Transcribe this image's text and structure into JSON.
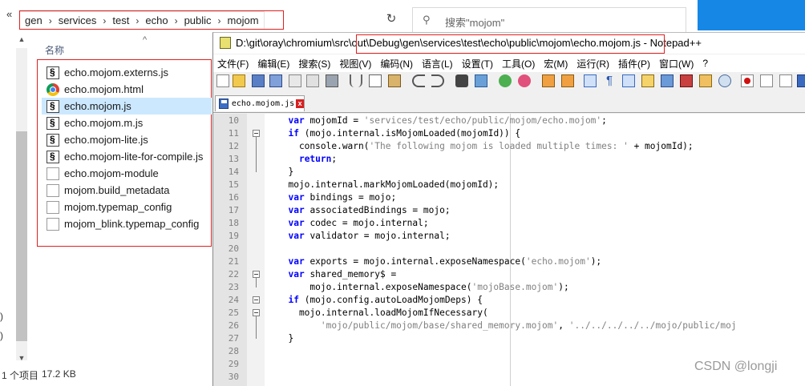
{
  "explorer": {
    "nav_chevron": "«",
    "breadcrumb": [
      "gen",
      "services",
      "test",
      "echo",
      "public",
      "mojom"
    ],
    "breadcrumb_sep": "›",
    "refresh_glyph": "↻",
    "search_placeholder": "搜索\"mojom\"",
    "column_header": "名称",
    "sort_glyph": "^",
    "files": [
      {
        "name": "echo.mojom.externs.js",
        "icon": "js",
        "selected": false
      },
      {
        "name": "echo.mojom.html",
        "icon": "html",
        "selected": false
      },
      {
        "name": "echo.mojom.js",
        "icon": "js",
        "selected": true
      },
      {
        "name": "echo.mojom.m.js",
        "icon": "js",
        "selected": false
      },
      {
        "name": "echo.mojom-lite.js",
        "icon": "js",
        "selected": false
      },
      {
        "name": "echo.mojom-lite-for-compile.js",
        "icon": "js",
        "selected": false
      },
      {
        "name": "echo.mojom-module",
        "icon": "blank",
        "selected": false
      },
      {
        "name": "mojom.build_metadata",
        "icon": "blank",
        "selected": false
      },
      {
        "name": "mojom.typemap_config",
        "icon": "blank",
        "selected": false
      },
      {
        "name": "mojom_blink.typemap_config",
        "icon": "blank",
        "selected": false
      }
    ],
    "pane_chars": [
      ")",
      ")"
    ],
    "status_items": "1 个项目",
    "status_size": "17.2 KB"
  },
  "npp": {
    "title_prefix": "D:\\git\\oray\\chromium\\src\\",
    "title_path": "out\\Debug\\gen\\services\\test\\echo\\public\\mojom\\echo.mojom.js",
    "title_suffix": " - Notepad++",
    "menu": [
      "文件(F)",
      "编辑(E)",
      "搜索(S)",
      "视图(V)",
      "编码(N)",
      "语言(L)",
      "设置(T)",
      "工具(O)",
      "宏(M)",
      "运行(R)",
      "插件(P)",
      "窗口(W)",
      "?"
    ],
    "tab_label": "echo.mojom.js",
    "tab_close": "x",
    "lines": [
      {
        "n": "10",
        "fold": "",
        "html": "  <span class=\"kw\">var</span> mojomId = <span class=\"str\">'services/test/echo/public/mojom/echo.mojom'</span>;"
      },
      {
        "n": "11",
        "fold": "open",
        "html": "  <span class=\"kw\">if</span> (mojo.internal.isMojomLoaded(mojomId)) {"
      },
      {
        "n": "12",
        "fold": "",
        "html": "    console.warn(<span class=\"str\">'The following mojom is loaded multiple times: '</span> + mojomId);"
      },
      {
        "n": "13",
        "fold": "",
        "html": "    <span class=\"kw\">return</span>;"
      },
      {
        "n": "14",
        "fold": "end",
        "html": "  }"
      },
      {
        "n": "15",
        "fold": "",
        "html": "  mojo.internal.markMojomLoaded(mojomId);"
      },
      {
        "n": "16",
        "fold": "",
        "html": "  <span class=\"kw\">var</span> bindings = mojo;"
      },
      {
        "n": "17",
        "fold": "",
        "html": "  <span class=\"kw\">var</span> associatedBindings = mojo;"
      },
      {
        "n": "18",
        "fold": "",
        "html": "  <span class=\"kw\">var</span> codec = mojo.internal;"
      },
      {
        "n": "19",
        "fold": "",
        "html": "  <span class=\"kw\">var</span> validator = mojo.internal;"
      },
      {
        "n": "20",
        "fold": "",
        "html": ""
      },
      {
        "n": "21",
        "fold": "",
        "html": "  <span class=\"kw\">var</span> exports = mojo.internal.exposeNamespace(<span class=\"str\">'echo.mojom'</span>);"
      },
      {
        "n": "22",
        "fold": "open",
        "html": "  <span class=\"kw\">var</span> shared_memory$ ="
      },
      {
        "n": "23",
        "fold": "end",
        "html": "      mojo.internal.exposeNamespace(<span class=\"str\">'mojoBase.mojom'</span>);"
      },
      {
        "n": "24",
        "fold": "open",
        "html": "  <span class=\"kw\">if</span> (mojo.config.autoLoadMojomDeps) {"
      },
      {
        "n": "25",
        "fold": "open",
        "html": "    mojo.internal.loadMojomIfNecessary("
      },
      {
        "n": "26",
        "fold": "",
        "html": "        <span class=\"str\">'mojo/public/mojom/base/shared_memory.mojom'</span>, <span class=\"str\">'../../../../../mojo/public/moj</span>"
      },
      {
        "n": "27",
        "fold": "end",
        "html": "  }"
      },
      {
        "n": "28",
        "fold": "",
        "html": ""
      },
      {
        "n": "29",
        "fold": "",
        "html": ""
      },
      {
        "n": "30",
        "fold": "",
        "html": ""
      }
    ]
  },
  "watermark": "CSDN @longji"
}
